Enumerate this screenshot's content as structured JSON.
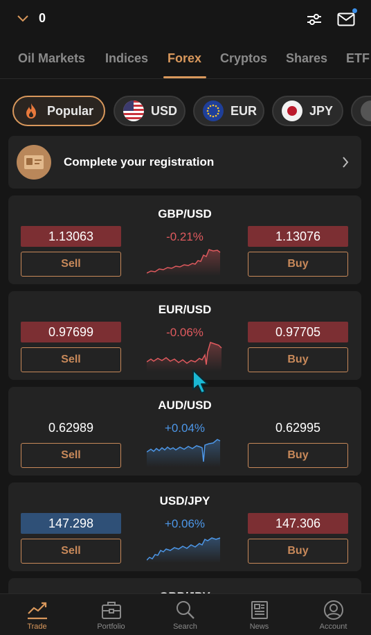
{
  "header": {
    "balance": "0",
    "icons": [
      "chevron-down-icon",
      "sliders-icon",
      "mail-icon"
    ]
  },
  "tabs": [
    {
      "label": "Oil Markets"
    },
    {
      "label": "Indices"
    },
    {
      "label": "Forex",
      "active": true
    },
    {
      "label": "Cryptos"
    },
    {
      "label": "Shares"
    },
    {
      "label": "ETF"
    }
  ],
  "filters": [
    {
      "label": "Popular",
      "icon": "fire-icon",
      "active": true
    },
    {
      "label": "USD",
      "icon": "us-flag-icon"
    },
    {
      "label": "EUR",
      "icon": "eu-flag-icon"
    },
    {
      "label": "JPY",
      "icon": "jp-flag-icon"
    }
  ],
  "registration": {
    "text": "Complete your registration"
  },
  "instruments": [
    {
      "pair": "GBP/USD",
      "sell_price": "1.13063",
      "buy_price": "1.13076",
      "change": "-0.21%",
      "sell_label": "Sell",
      "buy_label": "Buy",
      "sell_highlight": "#7c2f33",
      "buy_highlight": "#7c2f33",
      "trend_color": "#e05a5e"
    },
    {
      "pair": "EUR/USD",
      "sell_price": "0.97699",
      "buy_price": "0.97705",
      "change": "-0.06%",
      "sell_label": "Sell",
      "buy_label": "Buy",
      "sell_highlight": "#7c2f33",
      "buy_highlight": "#7c2f33",
      "trend_color": "#e05a5e"
    },
    {
      "pair": "AUD/USD",
      "sell_price": "0.62989",
      "buy_price": "0.62995",
      "change": "+0.04%",
      "sell_label": "Sell",
      "buy_label": "Buy",
      "sell_highlight": "none",
      "buy_highlight": "none",
      "trend_color": "#4d97e8"
    },
    {
      "pair": "USD/JPY",
      "sell_price": "147.298",
      "buy_price": "147.306",
      "change": "+0.06%",
      "sell_label": "Sell",
      "buy_label": "Buy",
      "sell_highlight": "#2f5077",
      "buy_highlight": "#7c2f33",
      "trend_color": "#4d97e8"
    }
  ],
  "partial_instrument": {
    "pair": "GBP/JPY"
  },
  "bottom_nav": [
    {
      "label": "Trade",
      "icon": "trade-chart-icon",
      "active": true
    },
    {
      "label": "Portfolio",
      "icon": "briefcase-icon"
    },
    {
      "label": "Search",
      "icon": "search-icon"
    },
    {
      "label": "News",
      "icon": "newspaper-icon"
    },
    {
      "label": "Account",
      "icon": "account-icon"
    }
  ],
  "colors": {
    "accent": "#d9985c",
    "background": "#161616",
    "card": "#232323",
    "negative": "#e05a5e",
    "positive": "#4d97e8"
  }
}
